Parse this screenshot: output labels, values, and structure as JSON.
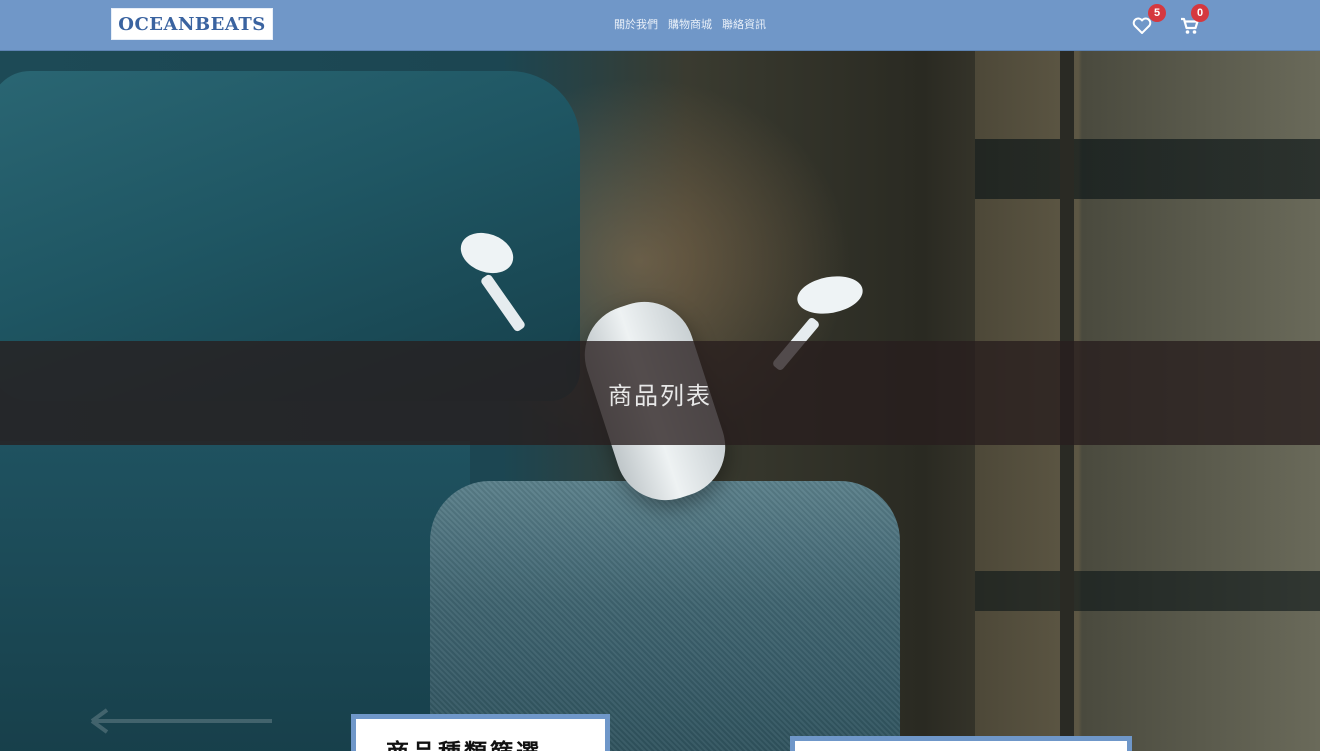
{
  "navbar": {
    "brand": "OCEANBEATS",
    "links": [
      "關於我們",
      "購物商城",
      "聯絡資訊"
    ],
    "wishlist": {
      "icon": "heart-icon",
      "count": "5"
    },
    "cart": {
      "icon": "cart-icon",
      "count": "0"
    }
  },
  "hero": {
    "title": "商品列表"
  },
  "sidebar": {
    "filter_title": "商品種類篩選"
  },
  "colors": {
    "navbar": "#7097c8",
    "badge": "#d5383f",
    "card_border": "#6f97c9"
  }
}
